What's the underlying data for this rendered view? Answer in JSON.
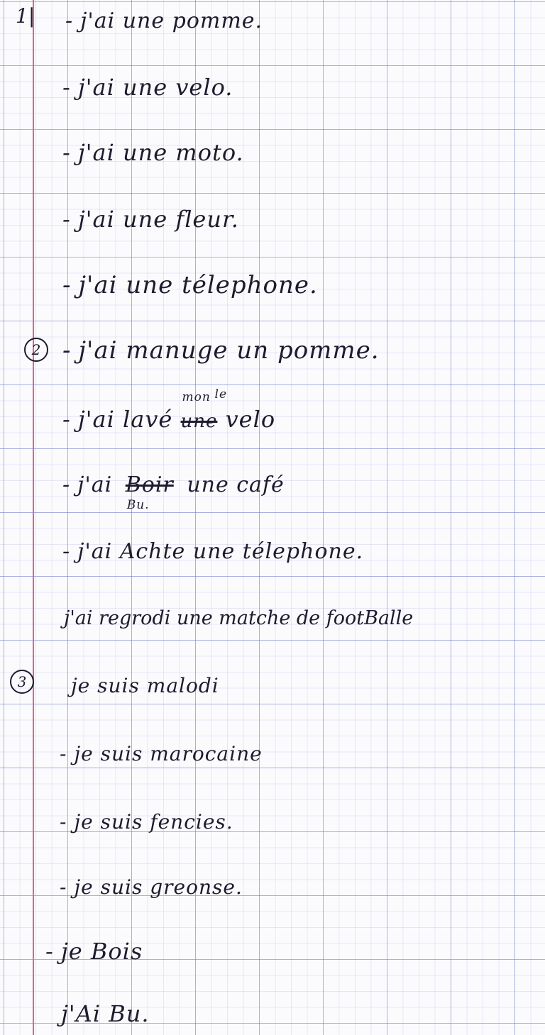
{
  "sections": [
    {
      "marker": "1|",
      "lines": [
        "j'ai une pomme.",
        "j'ai une velo.",
        "j'ai une moto.",
        "j'ai une fleur.",
        "j'ai une télephone."
      ]
    },
    {
      "marker": "2",
      "lines": [
        "j'ai manuge un pomme.",
        {
          "before": "j'ai lavé",
          "corrections": [
            "mon",
            "le"
          ],
          "struck": "une",
          "after": "velo"
        },
        {
          "before": "j'ai",
          "struck": "Boir",
          "correction": "Bu.",
          "after": "une café"
        },
        "j'ai Achte une télephone.",
        "j'ai regrodi une matche de footBalle"
      ]
    },
    {
      "marker": "3",
      "lines": [
        "je suis malodi",
        "je suis marocaine",
        "je suis fencies.",
        "je suis greonse.",
        "je Bois",
        "j'Ai Bu."
      ]
    }
  ]
}
